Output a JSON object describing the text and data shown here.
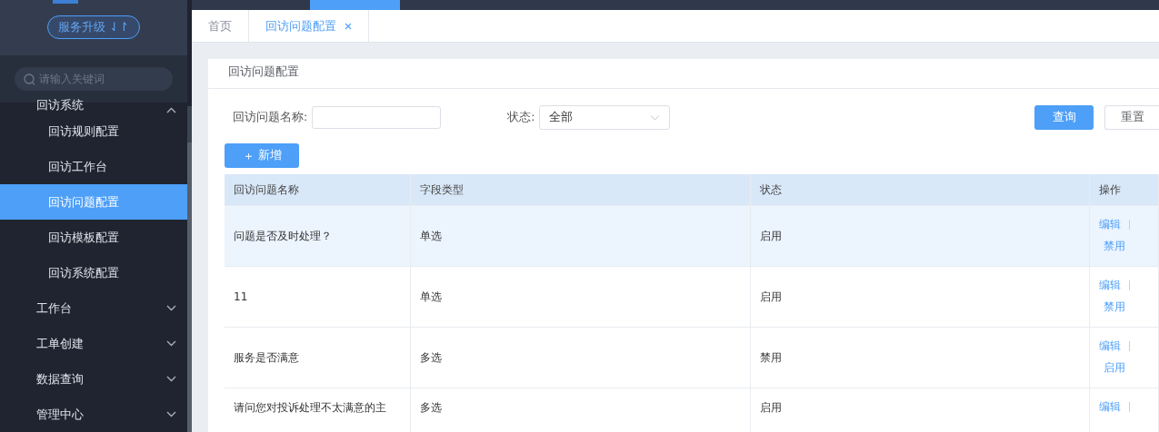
{
  "sidebar": {
    "upgrade_button": {
      "label": "服务升级",
      "icon": "⇃↾"
    },
    "search": {
      "placeholder": "请输入关键词"
    },
    "menu": [
      {
        "label": "回访系统",
        "expanded": true,
        "children": [
          {
            "label": "回访规则配置",
            "selected": false
          },
          {
            "label": "回访工作台",
            "selected": false
          },
          {
            "label": "回访问题配置",
            "selected": true
          },
          {
            "label": "回访模板配置",
            "selected": false
          },
          {
            "label": "回访系统配置",
            "selected": false
          }
        ]
      },
      {
        "label": "工作台",
        "expanded": false
      },
      {
        "label": "工单创建",
        "expanded": false
      },
      {
        "label": "数据查询",
        "expanded": false
      },
      {
        "label": "管理中心",
        "expanded": false
      }
    ]
  },
  "tabs": [
    {
      "label": "首页",
      "selected": false,
      "closable": false
    },
    {
      "label": "回访问题配置",
      "selected": true,
      "closable": true
    }
  ],
  "card": {
    "title": "回访问题配置"
  },
  "filters": {
    "name_label": "回访问题名称:",
    "status_label": "状态:",
    "status_value": "全部",
    "query_button": "查询",
    "reset_button": "重置"
  },
  "add_button": {
    "icon": "＋",
    "label": "新增"
  },
  "table": {
    "columns": [
      "回访问题名称",
      "字段类型",
      "状态",
      "操作"
    ],
    "rows": [
      {
        "name": "问题是否及时处理？",
        "type": "单选",
        "status": "启用",
        "hovered": true,
        "actions": [
          "编辑",
          "禁用"
        ]
      },
      {
        "name": "11",
        "type": "单选",
        "status": "启用",
        "hovered": false,
        "actions": [
          "编辑",
          "禁用"
        ]
      },
      {
        "name": "服务是否满意",
        "type": "多选",
        "status": "禁用",
        "hovered": false,
        "actions": [
          "编辑",
          "启用"
        ]
      },
      {
        "name": "请问您对投诉处理不太满意的主",
        "type": "多选",
        "status": "启用",
        "hovered": false,
        "actions": [
          "编辑"
        ]
      }
    ]
  }
}
